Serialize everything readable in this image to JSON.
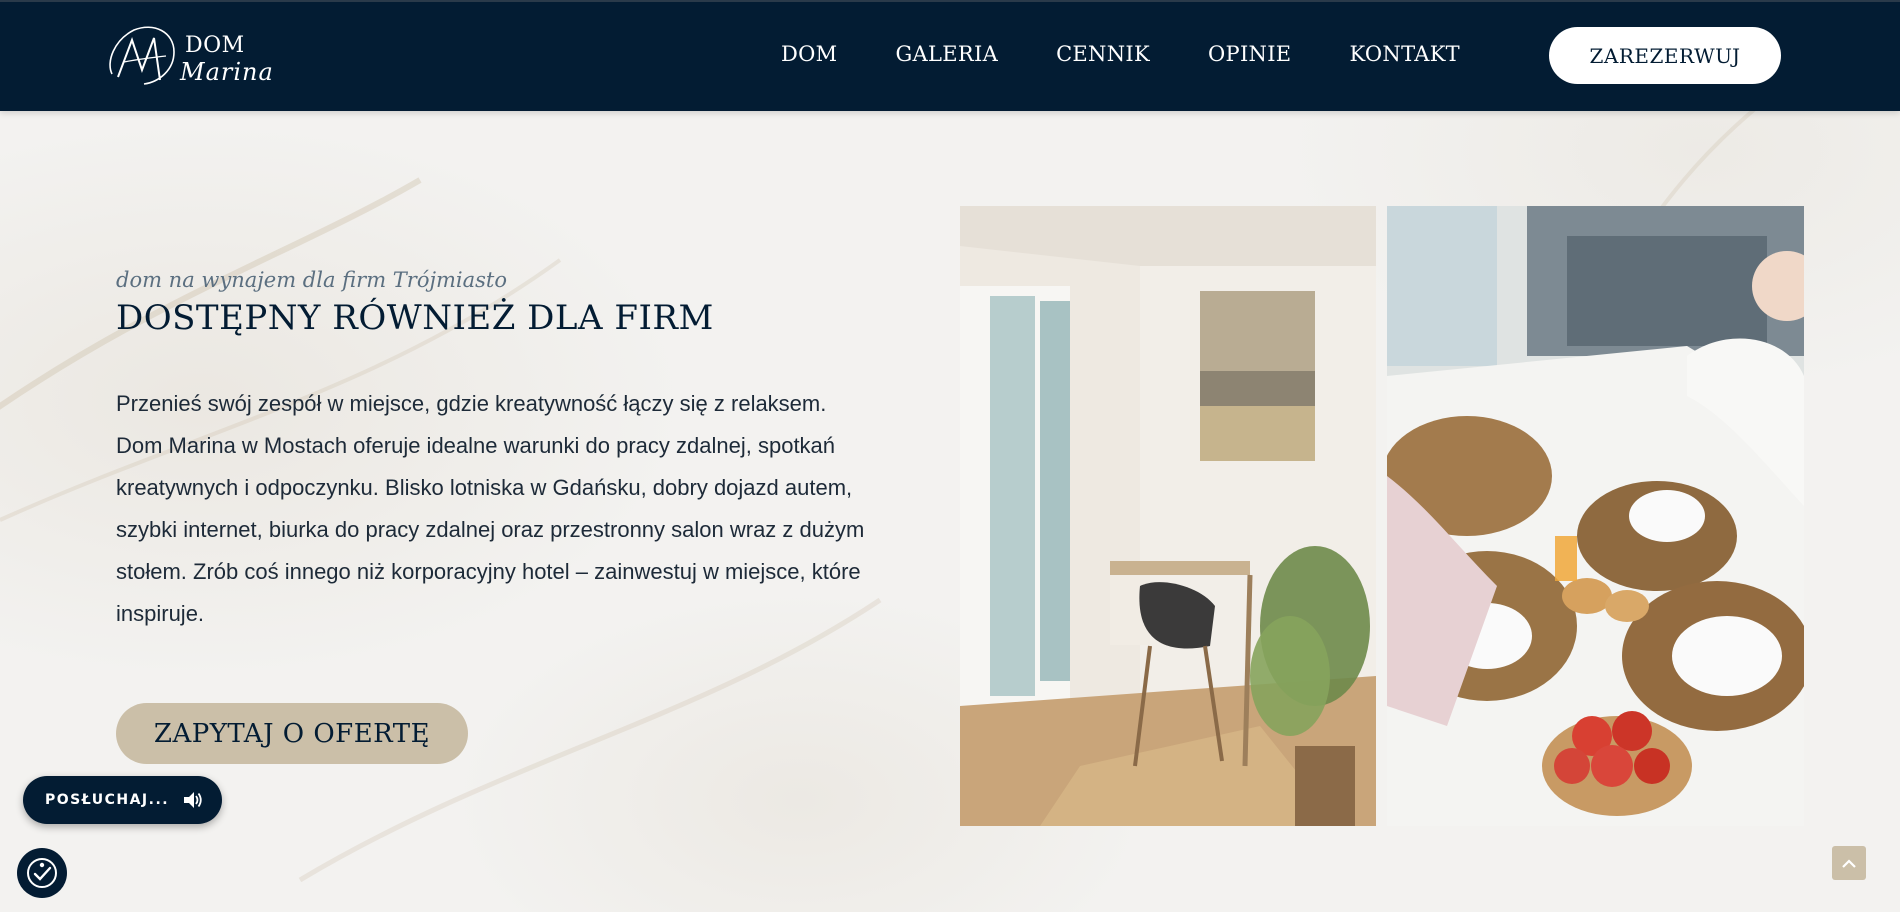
{
  "header": {
    "logo_line1": "DOM",
    "logo_line2": "Marina",
    "nav": [
      "DOM",
      "GALERIA",
      "CENNIK",
      "OPINIE",
      "KONTAKT"
    ],
    "reserve_label": "ZAREZERWUJ"
  },
  "main": {
    "subtitle": "dom na wynajem dla firm Trójmiasto",
    "title": "DOSTĘPNY RÓWNIEŻ DLA FIRM",
    "body": "Przenieś swój zespół w miejsce, gdzie kreatywność łączy się z relaksem. Dom Marina w Mostach oferuje idealne warunki do pracy zdalnej, spotkań kreatywnych i odpoczynku. Blisko lotniska w Gdańsku, dobry dojazd autem, szybki internet, biurka do pracy zdalnej oraz przestronny salon wraz z dużym stołem. Zrób coś innego niż korporacyjny hotel – zainwestuj w miejsce, które inspiruje.",
    "cta_label": "ZAPYTAJ O OFERTĘ"
  },
  "widgets": {
    "listen_label": "POSŁUCHAJ...",
    "speaker_icon": "speaker-icon",
    "accessibility_icon": "accessibility-icon",
    "scroll_top_icon": "chevron-up-icon"
  },
  "colors": {
    "navy": "#031c33",
    "sand": "#cbbfa8",
    "background": "#f3f2f0"
  }
}
